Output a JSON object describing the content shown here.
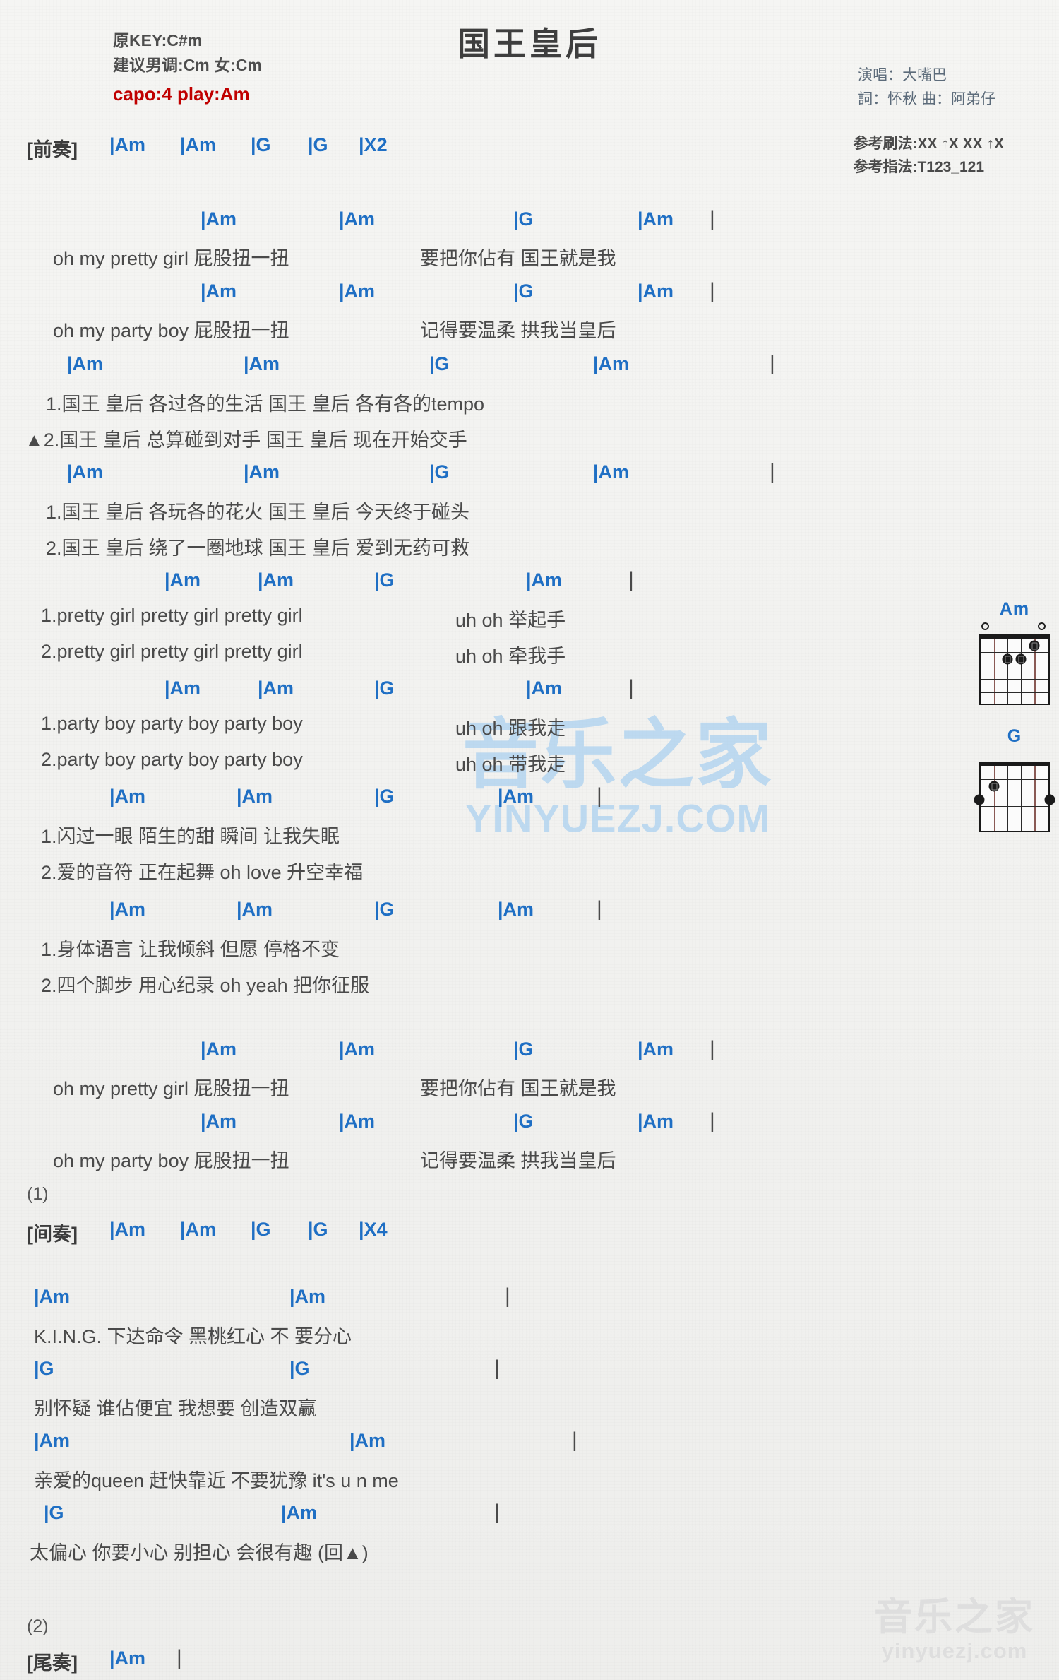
{
  "header": {
    "title": "国王皇后",
    "orig_key": "原KEY:C#m",
    "suggest_key": "建议男调:Cm 女:Cm",
    "capo": "capo:4 play:Am",
    "singer": "演唱：大嘴巴",
    "writer": "詞：怀秋  曲：阿弟仔",
    "strum": "参考刷法:XX ↑X XX ↑X",
    "fingerstyle": "参考指法:T123_121"
  },
  "watermark": {
    "center_cn": "音乐之家",
    "center_url": "YINYUEZJ.COM",
    "corner_cn": "音乐之家",
    "corner_url": "yinyuezj.com"
  },
  "intro": {
    "label": "[前奏]",
    "chords": [
      "|Am",
      "|Am",
      "|G",
      "|G",
      "|X2"
    ]
  },
  "interlude": {
    "marker": "(1)",
    "label": "[间奏]",
    "chords": [
      "|Am",
      "|Am",
      "|G",
      "|G",
      "|X4"
    ]
  },
  "outro": {
    "marker": "(2)",
    "label": "[尾奏]",
    "chords": [
      "|Am",
      "|"
    ]
  },
  "sections": [
    {
      "id": "verse1a",
      "chords": [
        "|Am",
        "|Am",
        "|G",
        "|Am",
        "|"
      ],
      "lyrics": [
        "oh my pretty girl 屁股扭一扭",
        "要把你佔有 国王就是我"
      ]
    },
    {
      "id": "verse1b",
      "chords": [
        "|Am",
        "|Am",
        "|G",
        "|Am",
        "|"
      ],
      "lyrics": [
        "oh my party boy 屁股扭一扭",
        "记得要温柔 拱我当皇后"
      ]
    },
    {
      "id": "verse2a",
      "chords": [
        "|Am",
        "|Am",
        "|G",
        "|Am",
        "|"
      ],
      "line1": "1.国王    皇后    各过各的生活     国王    皇后    各有各的tempo",
      "line2": "▲2.国王    皇后    总算碰到对手     国王    皇后    现在开始交手"
    },
    {
      "id": "verse2b",
      "chords": [
        "|Am",
        "|Am",
        "|G",
        "|Am",
        "|"
      ],
      "line1": "1.国王    皇后    各玩各的花火     国王    皇后    今天终于碰头",
      "line2": "2.国王    皇后    绕了一圈地球     国王    皇后    爱到无药可救"
    },
    {
      "id": "prettygirl",
      "chords": [
        "|Am",
        "|Am",
        "|G",
        "|Am",
        "|"
      ],
      "line1": "1.pretty girl pretty girl pretty girl",
      "line1b": "uh oh 举起手",
      "line2": "2.pretty girl pretty girl pretty girl",
      "line2b": "uh oh 牵我手"
    },
    {
      "id": "partyboy",
      "chords": [
        "|Am",
        "|Am",
        "|G",
        "|Am",
        "|"
      ],
      "line1": "1.party boy party boy party boy",
      "line1b": "uh oh 跟我走",
      "line2": "2.party boy party boy party boy",
      "line2b": "uh oh 带我走"
    },
    {
      "id": "chorus1",
      "chords": [
        "|Am",
        "|Am",
        "|G",
        "|Am",
        "|"
      ],
      "line1": "1.闪过一眼    陌生的甜    瞬间         让我失眠",
      "line2": "2.爱的音符    正在起舞    oh love    升空幸福"
    },
    {
      "id": "chorus2",
      "chords": [
        "|Am",
        "|Am",
        "|G",
        "|Am",
        "|"
      ],
      "line1": "1.身体语言    让我倾斜    但愿         停格不变",
      "line2": "2.四个脚步    用心纪录    oh yeah    把你征服"
    },
    {
      "id": "verse3a",
      "chords": [
        "|Am",
        "|Am",
        "|G",
        "|Am",
        "|"
      ],
      "lyrics": [
        "oh my pretty girl 屁股扭一扭",
        "要把你佔有 国王就是我"
      ]
    },
    {
      "id": "verse3b",
      "chords": [
        "|Am",
        "|Am",
        "|G",
        "|Am",
        "|"
      ],
      "lyrics": [
        "oh my party boy 屁股扭一扭",
        "记得要温柔 拱我当皇后"
      ]
    }
  ],
  "rap": [
    {
      "chords": [
        "|Am",
        "|Am",
        "|"
      ],
      "lyric": "K.I.N.G.      下达命令     黑桃红心 不    要分心"
    },
    {
      "chords": [
        "|G",
        "|G",
        "|"
      ],
      "lyric": "别怀疑      谁佔便宜     我想要     创造双赢"
    },
    {
      "chords": [
        "|Am",
        "|Am",
        "|"
      ],
      "lyric": "亲爱的queen      赶快靠近    不要犹豫     it's u n me"
    },
    {
      "chords": [
        "|G",
        "|Am",
        "|"
      ],
      "lyric": "太偏心      你要小心      别担心      会很有趣         (回▲)"
    }
  ],
  "diagrams": [
    {
      "name": "Am",
      "open_strings": [
        1,
        5
      ],
      "dots": [
        {
          "string": 2,
          "fret": 1
        },
        {
          "string": 3,
          "fret": 2
        },
        {
          "string": 4,
          "fret": 2
        }
      ]
    },
    {
      "name": "G",
      "open_strings": [],
      "dots": [
        {
          "string": 5,
          "fret": 2
        }
      ],
      "side_dots": [
        {
          "side": "left",
          "fret": 3
        },
        {
          "side": "right",
          "fret": 3
        }
      ]
    }
  ]
}
